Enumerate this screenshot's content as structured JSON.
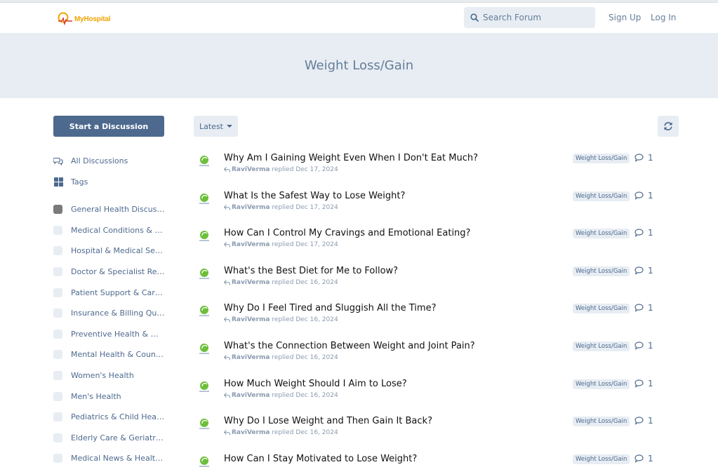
{
  "header": {
    "logo_text": "MyHospital",
    "search_placeholder": "Search Forum",
    "signup_label": "Sign Up",
    "login_label": "Log In"
  },
  "hero": {
    "title": "Weight Loss/Gain"
  },
  "sidebar": {
    "start_label": "Start a Discussion",
    "nav": [
      {
        "label": "All Discussions",
        "icon": "comments-icon"
      },
      {
        "label": "Tags",
        "icon": "grid-icon"
      }
    ],
    "tags": [
      {
        "label": "General Health Discussions",
        "swatch": "#7a7a7a"
      },
      {
        "label": "Medical Conditions & Diseases",
        "swatch": "#e7edf3"
      },
      {
        "label": "Hospital & Medical Services",
        "swatch": "#e7edf3"
      },
      {
        "label": "Doctor & Specialist Reviews",
        "swatch": "#e7edf3"
      },
      {
        "label": "Patient Support & Caregivers",
        "swatch": "#e7edf3"
      },
      {
        "label": "Insurance & Billing Questions",
        "swatch": "#e7edf3"
      },
      {
        "label": "Preventive Health & Wellness",
        "swatch": "#e7edf3"
      },
      {
        "label": "Mental Health & Counseling",
        "swatch": "#e7edf3"
      },
      {
        "label": "Women's Health",
        "swatch": "#e7edf3"
      },
      {
        "label": "Men's Health",
        "swatch": "#e7edf3"
      },
      {
        "label": "Pediatrics & Child Health",
        "swatch": "#e7edf3"
      },
      {
        "label": "Elderly Care & Geriatrics",
        "swatch": "#e7edf3"
      },
      {
        "label": "Medical News & Health Innovations",
        "swatch": "#e7edf3"
      }
    ]
  },
  "toolbar": {
    "sort_label": "Latest"
  },
  "discussions": [
    {
      "title": "Why Am I Gaining Weight Even When I Don't Eat Much?",
      "user": "RaviVerma",
      "action": "replied",
      "date": "Dec 17, 2024",
      "tag": "Weight Loss/Gain",
      "replies": "1"
    },
    {
      "title": "What Is the Safest Way to Lose Weight?",
      "user": "RaviVerma",
      "action": "replied",
      "date": "Dec 17, 2024",
      "tag": "Weight Loss/Gain",
      "replies": "1"
    },
    {
      "title": "How Can I Control My Cravings and Emotional Eating?",
      "user": "RaviVerma",
      "action": "replied",
      "date": "Dec 17, 2024",
      "tag": "Weight Loss/Gain",
      "replies": "1"
    },
    {
      "title": "What's the Best Diet for Me to Follow?",
      "user": "RaviVerma",
      "action": "replied",
      "date": "Dec 16, 2024",
      "tag": "Weight Loss/Gain",
      "replies": "1"
    },
    {
      "title": "Why Do I Feel Tired and Sluggish All the Time?",
      "user": "RaviVerma",
      "action": "replied",
      "date": "Dec 16, 2024",
      "tag": "Weight Loss/Gain",
      "replies": "1"
    },
    {
      "title": "What's the Connection Between Weight and Joint Pain?",
      "user": "RaviVerma",
      "action": "replied",
      "date": "Dec 16, 2024",
      "tag": "Weight Loss/Gain",
      "replies": "1"
    },
    {
      "title": "How Much Weight Should I Aim to Lose?",
      "user": "RaviVerma",
      "action": "replied",
      "date": "Dec 16, 2024",
      "tag": "Weight Loss/Gain",
      "replies": "1"
    },
    {
      "title": "Why Do I Lose Weight and Then Gain It Back?",
      "user": "RaviVerma",
      "action": "replied",
      "date": "Dec 16, 2024",
      "tag": "Weight Loss/Gain",
      "replies": "1"
    },
    {
      "title": "How Can I Stay Motivated to Lose Weight?",
      "user": "RaviVerma",
      "action": "replied",
      "date": "Dec 16, 2024",
      "tag": "Weight Loss/Gain",
      "replies": "1"
    }
  ]
}
